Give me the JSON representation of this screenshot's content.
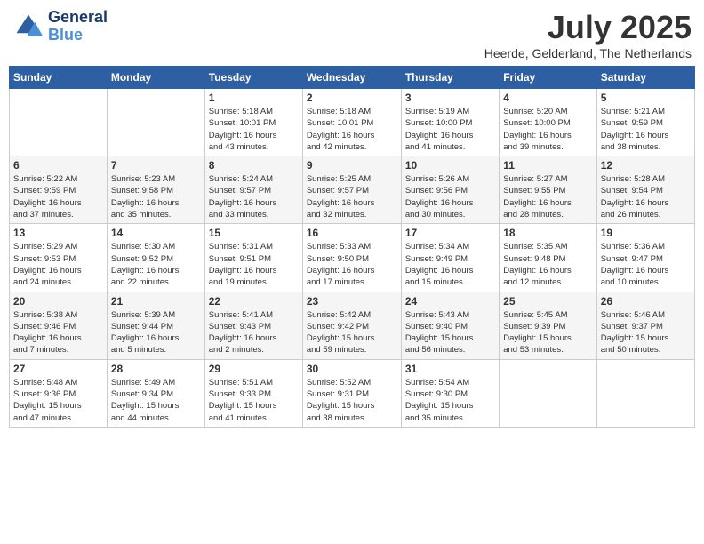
{
  "header": {
    "logo_line1": "General",
    "logo_line2": "Blue",
    "month_title": "July 2025",
    "location": "Heerde, Gelderland, The Netherlands"
  },
  "weekdays": [
    "Sunday",
    "Monday",
    "Tuesday",
    "Wednesday",
    "Thursday",
    "Friday",
    "Saturday"
  ],
  "weeks": [
    [
      {
        "day": "",
        "content": ""
      },
      {
        "day": "",
        "content": ""
      },
      {
        "day": "1",
        "content": "Sunrise: 5:18 AM\nSunset: 10:01 PM\nDaylight: 16 hours\nand 43 minutes."
      },
      {
        "day": "2",
        "content": "Sunrise: 5:18 AM\nSunset: 10:01 PM\nDaylight: 16 hours\nand 42 minutes."
      },
      {
        "day": "3",
        "content": "Sunrise: 5:19 AM\nSunset: 10:00 PM\nDaylight: 16 hours\nand 41 minutes."
      },
      {
        "day": "4",
        "content": "Sunrise: 5:20 AM\nSunset: 10:00 PM\nDaylight: 16 hours\nand 39 minutes."
      },
      {
        "day": "5",
        "content": "Sunrise: 5:21 AM\nSunset: 9:59 PM\nDaylight: 16 hours\nand 38 minutes."
      }
    ],
    [
      {
        "day": "6",
        "content": "Sunrise: 5:22 AM\nSunset: 9:59 PM\nDaylight: 16 hours\nand 37 minutes."
      },
      {
        "day": "7",
        "content": "Sunrise: 5:23 AM\nSunset: 9:58 PM\nDaylight: 16 hours\nand 35 minutes."
      },
      {
        "day": "8",
        "content": "Sunrise: 5:24 AM\nSunset: 9:57 PM\nDaylight: 16 hours\nand 33 minutes."
      },
      {
        "day": "9",
        "content": "Sunrise: 5:25 AM\nSunset: 9:57 PM\nDaylight: 16 hours\nand 32 minutes."
      },
      {
        "day": "10",
        "content": "Sunrise: 5:26 AM\nSunset: 9:56 PM\nDaylight: 16 hours\nand 30 minutes."
      },
      {
        "day": "11",
        "content": "Sunrise: 5:27 AM\nSunset: 9:55 PM\nDaylight: 16 hours\nand 28 minutes."
      },
      {
        "day": "12",
        "content": "Sunrise: 5:28 AM\nSunset: 9:54 PM\nDaylight: 16 hours\nand 26 minutes."
      }
    ],
    [
      {
        "day": "13",
        "content": "Sunrise: 5:29 AM\nSunset: 9:53 PM\nDaylight: 16 hours\nand 24 minutes."
      },
      {
        "day": "14",
        "content": "Sunrise: 5:30 AM\nSunset: 9:52 PM\nDaylight: 16 hours\nand 22 minutes."
      },
      {
        "day": "15",
        "content": "Sunrise: 5:31 AM\nSunset: 9:51 PM\nDaylight: 16 hours\nand 19 minutes."
      },
      {
        "day": "16",
        "content": "Sunrise: 5:33 AM\nSunset: 9:50 PM\nDaylight: 16 hours\nand 17 minutes."
      },
      {
        "day": "17",
        "content": "Sunrise: 5:34 AM\nSunset: 9:49 PM\nDaylight: 16 hours\nand 15 minutes."
      },
      {
        "day": "18",
        "content": "Sunrise: 5:35 AM\nSunset: 9:48 PM\nDaylight: 16 hours\nand 12 minutes."
      },
      {
        "day": "19",
        "content": "Sunrise: 5:36 AM\nSunset: 9:47 PM\nDaylight: 16 hours\nand 10 minutes."
      }
    ],
    [
      {
        "day": "20",
        "content": "Sunrise: 5:38 AM\nSunset: 9:46 PM\nDaylight: 16 hours\nand 7 minutes."
      },
      {
        "day": "21",
        "content": "Sunrise: 5:39 AM\nSunset: 9:44 PM\nDaylight: 16 hours\nand 5 minutes."
      },
      {
        "day": "22",
        "content": "Sunrise: 5:41 AM\nSunset: 9:43 PM\nDaylight: 16 hours\nand 2 minutes."
      },
      {
        "day": "23",
        "content": "Sunrise: 5:42 AM\nSunset: 9:42 PM\nDaylight: 15 hours\nand 59 minutes."
      },
      {
        "day": "24",
        "content": "Sunrise: 5:43 AM\nSunset: 9:40 PM\nDaylight: 15 hours\nand 56 minutes."
      },
      {
        "day": "25",
        "content": "Sunrise: 5:45 AM\nSunset: 9:39 PM\nDaylight: 15 hours\nand 53 minutes."
      },
      {
        "day": "26",
        "content": "Sunrise: 5:46 AM\nSunset: 9:37 PM\nDaylight: 15 hours\nand 50 minutes."
      }
    ],
    [
      {
        "day": "27",
        "content": "Sunrise: 5:48 AM\nSunset: 9:36 PM\nDaylight: 15 hours\nand 47 minutes."
      },
      {
        "day": "28",
        "content": "Sunrise: 5:49 AM\nSunset: 9:34 PM\nDaylight: 15 hours\nand 44 minutes."
      },
      {
        "day": "29",
        "content": "Sunrise: 5:51 AM\nSunset: 9:33 PM\nDaylight: 15 hours\nand 41 minutes."
      },
      {
        "day": "30",
        "content": "Sunrise: 5:52 AM\nSunset: 9:31 PM\nDaylight: 15 hours\nand 38 minutes."
      },
      {
        "day": "31",
        "content": "Sunrise: 5:54 AM\nSunset: 9:30 PM\nDaylight: 15 hours\nand 35 minutes."
      },
      {
        "day": "",
        "content": ""
      },
      {
        "day": "",
        "content": ""
      }
    ]
  ]
}
